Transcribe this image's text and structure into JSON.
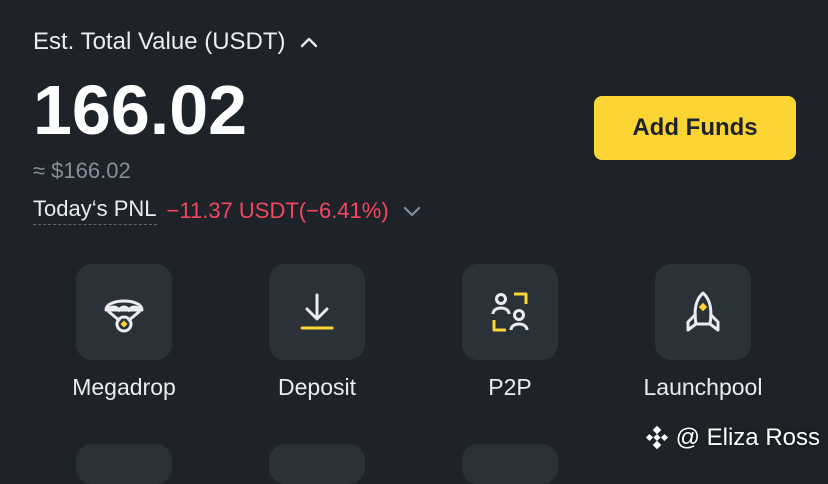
{
  "header": {
    "est_label": "Est. Total Value (USDT)",
    "total_value": "166.02",
    "approx_value": "≈ $166.02",
    "pnl_label": "Today‘s PNL",
    "pnl_value": "−11.37 USDT(−6.41%)"
  },
  "add_funds_label": "Add Funds",
  "actions": [
    {
      "label": "Megadrop",
      "icon": "parachute-icon"
    },
    {
      "label": "Deposit",
      "icon": "download-icon"
    },
    {
      "label": "P2P",
      "icon": "p2p-users-icon"
    },
    {
      "label": "Launchpool",
      "icon": "rocket-icon"
    }
  ],
  "watermark": {
    "text": "@ Eliza Ross",
    "icon": "binance-logo-icon"
  },
  "colors": {
    "background": "#1e2329",
    "tile": "#2b3139",
    "accent": "#fcd535",
    "negative": "#f6465d",
    "muted": "#848e9c"
  }
}
